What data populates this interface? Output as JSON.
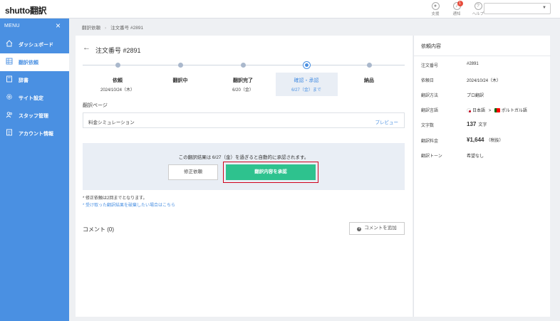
{
  "app": {
    "logo_latin": "shutto",
    "logo_jp": "翻訳"
  },
  "topbar": {
    "icons": [
      {
        "name": "support",
        "label": "支援",
        "icon": "support-icon"
      },
      {
        "name": "notice",
        "label": "通知",
        "icon": "bell-icon",
        "badge": "1"
      },
      {
        "name": "help",
        "label": "ヘルプ",
        "icon": "help-icon"
      }
    ],
    "account_select_value": ""
  },
  "sidebar": {
    "menu_label": "MENU",
    "items": [
      {
        "label": "ダッシュボード",
        "icon": "home-icon",
        "active": false
      },
      {
        "label": "翻訳依頼",
        "icon": "list-icon",
        "active": true
      },
      {
        "label": "辞書",
        "icon": "book-icon",
        "active": false
      },
      {
        "label": "サイト設定",
        "icon": "gear-icon",
        "active": false
      },
      {
        "label": "スタッフ管理",
        "icon": "users-icon",
        "active": false
      },
      {
        "label": "アカウント情報",
        "icon": "document-icon",
        "active": false
      }
    ]
  },
  "breadcrumb": {
    "parent": "翻訳依頼",
    "current": "注文番号 #2891"
  },
  "order": {
    "title": "注文番号 #2891",
    "steps": [
      {
        "name": "依頼",
        "date": "2024/10/24（木）",
        "current": false
      },
      {
        "name": "翻訳中",
        "date": "",
        "current": false
      },
      {
        "name": "翻訳完了",
        "date": "6/20（金）",
        "current": false
      },
      {
        "name": "確認・承認",
        "date": "6/27（金）まで",
        "current": true
      },
      {
        "name": "納品",
        "date": "",
        "current": false
      }
    ],
    "page_section_label": "翻訳ページ",
    "page_name": "料金シミュレーション",
    "preview_label": "プレビュー",
    "approve_message": "この翻訳結果は 6/27（金）を過ぎると自動的に承認されます。",
    "fix_button": "修正依頼",
    "approve_button": "翻訳内容を承認",
    "notes": [
      "* 修正依頼は2回までとなります。",
      "* 受け取った翻訳結果を破棄したい場合はこちら"
    ],
    "comment_title": "コメント (0)",
    "add_comment_button": "コメントを追加"
  },
  "details": {
    "title": "依頼内容",
    "rows": [
      {
        "key": "注文番号",
        "value": "#2891"
      },
      {
        "key": "依頼日",
        "value": "2024/10/24（木）"
      },
      {
        "key": "翻訳方法",
        "value": "プロ翻訳"
      },
      {
        "key": "翻訳言語",
        "value_from": "日本語",
        "value_arrow": ">",
        "value_to": "ポルトガル語"
      },
      {
        "key": "文字数",
        "value_num": "137",
        "value_unit": "文字"
      },
      {
        "key": "翻訳料金",
        "value_num": "¥1,644",
        "value_unit": "（税抜）"
      },
      {
        "key": "翻訳トーン",
        "value": "希望なし"
      }
    ]
  },
  "colors": {
    "sidebar": "#4a90e2",
    "approve": "#2ec28e",
    "highlight_frame": "#d0021b",
    "link": "#4a90e2"
  }
}
